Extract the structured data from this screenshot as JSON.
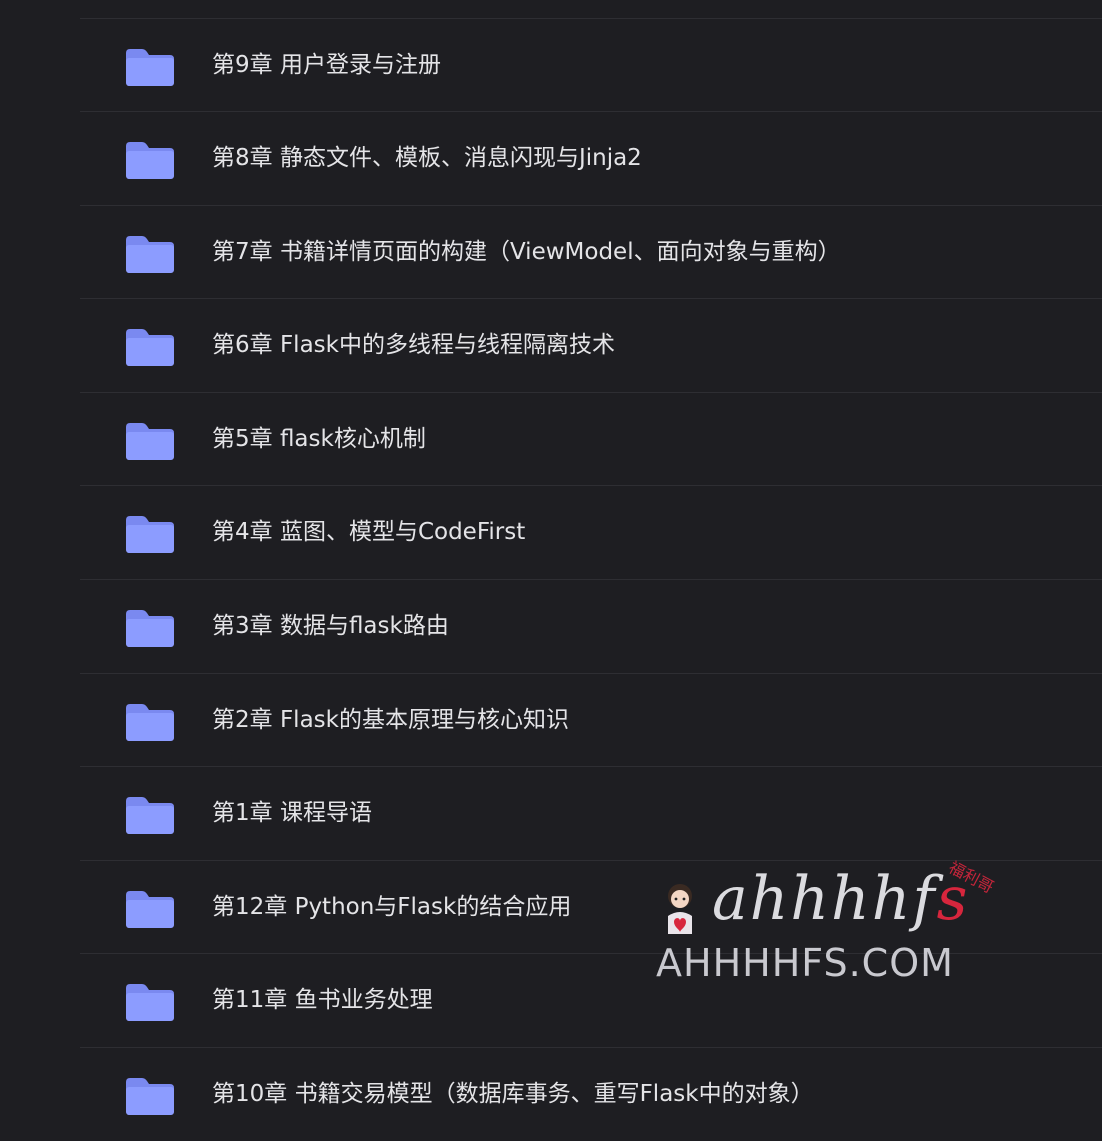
{
  "folders": [
    {
      "icon": "folder-icon",
      "name": "第9章 用户登录与注册"
    },
    {
      "icon": "folder-icon",
      "name": "第8章 静态文件、模板、消息闪现与Jinja2"
    },
    {
      "icon": "folder-icon",
      "name": "第7章 书籍详情页面的构建（ViewModel、面向对象与重构）"
    },
    {
      "icon": "folder-icon",
      "name": "第6章 Flask中的多线程与线程隔离技术"
    },
    {
      "icon": "folder-icon",
      "name": "第5章 flask核心机制"
    },
    {
      "icon": "folder-icon",
      "name": "第4章 蓝图、模型与CodeFirst"
    },
    {
      "icon": "folder-icon",
      "name": "第3章 数据与flask路由"
    },
    {
      "icon": "folder-icon",
      "name": "第2章 Flask的基本原理与核心知识"
    },
    {
      "icon": "folder-icon",
      "name": "第1章 课程导语"
    },
    {
      "icon": "folder-icon",
      "name": "第12章 Python与Flask的结合应用"
    },
    {
      "icon": "folder-icon",
      "name": "第11章 鱼书业务处理"
    },
    {
      "icon": "folder-icon",
      "name": "第10章 书籍交易模型（数据库事务、重写Flask中的对象）"
    }
  ],
  "watermark": {
    "brand_main": "ahhhhf",
    "brand_s": "s",
    "tag": "福利哥",
    "domain": "AHHHHFS.COM"
  },
  "colors": {
    "background": "#1e1e22",
    "folder_body": "#8c9cff",
    "folder_tab": "#7a89f0",
    "text": "#e4e4e7",
    "divider": "#2e2e33"
  }
}
